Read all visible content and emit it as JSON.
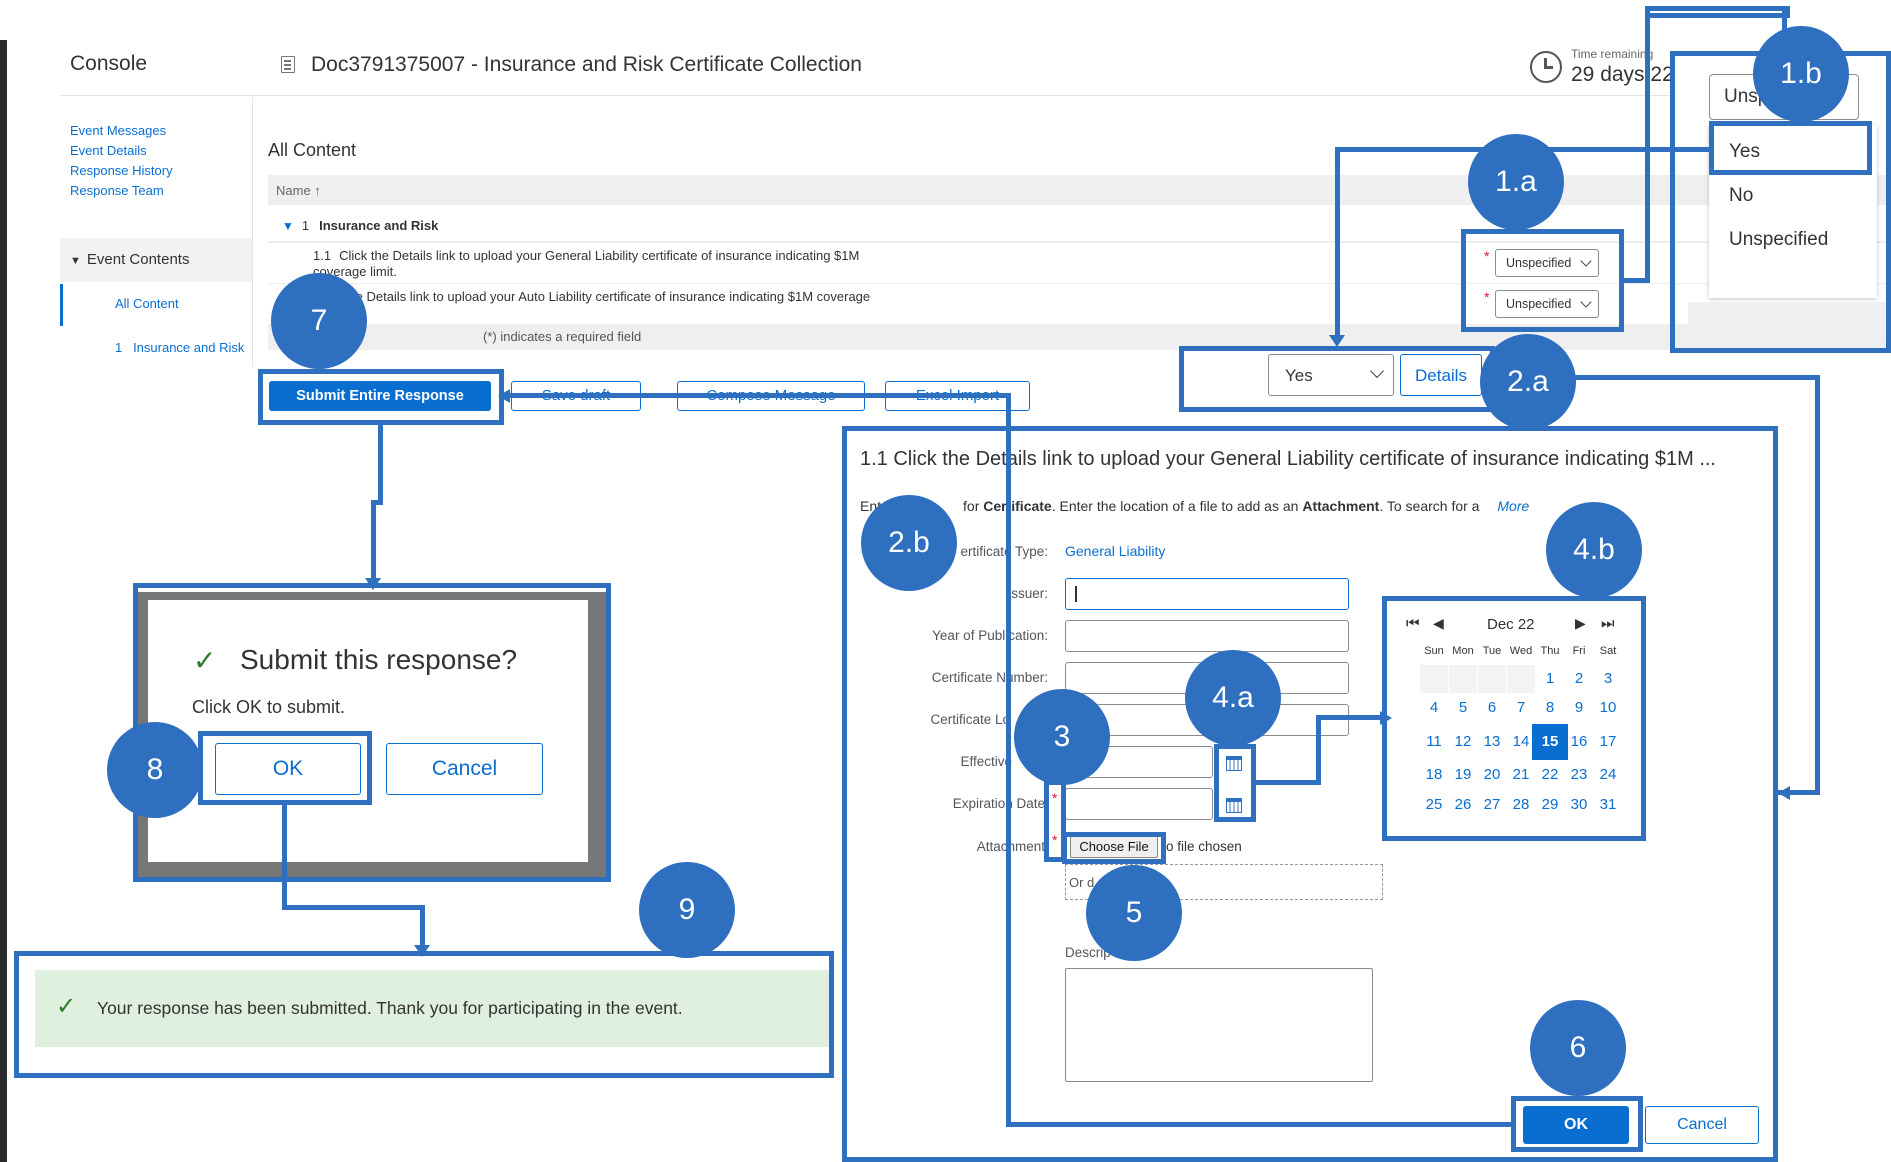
{
  "header": {
    "console": "Console",
    "doc_title": "Doc3791375007 - Insurance and Risk Certificate Collection",
    "time_label": "Time remaining",
    "time_value": "29 days 22"
  },
  "sidebar": {
    "links": [
      "Event Messages",
      "Event Details",
      "Response History",
      "Response Team"
    ],
    "event_contents": "Event Contents",
    "all_content": "All Content",
    "section_item": "1   Insurance and Risk"
  },
  "content": {
    "title": "All Content",
    "name_header": "Name ↑",
    "section_num": "1",
    "section_label": "Insurance and Risk",
    "q1_num": "1.1",
    "q1_text": "Click the Details link to upload your General Liability certificate of insurance indicating $1M coverage limit.",
    "q2_text": "Click the Details link to upload your Auto Liability certificate of insurance indicating $1M coverage limit.",
    "q1_value": "Unspecified",
    "q2_value": "Unspecified",
    "required_note": "(*) indicates a required field",
    "star": "*"
  },
  "buttons": {
    "submit": "Submit Entire Response",
    "save_draft": "Save draft",
    "compose": "Compose Message",
    "excel": "Excel Import"
  },
  "dropdown": {
    "current": "Unsp",
    "options": [
      "Yes",
      "No",
      "Unspecified"
    ]
  },
  "answer": {
    "value": "Yes",
    "details": "Details"
  },
  "details_panel": {
    "title": "1.1 Click the Details link to upload your General Liability certificate of insurance indicating $1M ...",
    "hint_pre": "Ent",
    "hint_mid1": "for",
    "hint_bold1": "Certificate",
    "hint_mid2": ". Enter the location of a file to add as an",
    "hint_bold2": "Attachment",
    "hint_end": ". To search for a",
    "more": "More",
    "labels": {
      "cert_type": "ertificate Type:",
      "issuer": "Issuer:",
      "year": "Year of Publication:",
      "cert_number": "Certificate Number:",
      "cert_loc": "Certificate Lo",
      "effective": "Effective",
      "expiration": "Expiration Date",
      "attachment": "Attachment",
      "description": "Descrip"
    },
    "cert_type_value": "General Liability",
    "choose_file": "Choose File",
    "no_file": "o file chosen",
    "drop_hint": "Or d",
    "ok": "OK",
    "cancel": "Cancel"
  },
  "calendar": {
    "month": "Dec 22",
    "weekdays": [
      "Sun",
      "Mon",
      "Tue",
      "Wed",
      "Thu",
      "Fri",
      "Sat"
    ],
    "weeks": [
      [
        "",
        "",
        "",
        "",
        "1",
        "2",
        "3"
      ],
      [
        "4",
        "5",
        "6",
        "7",
        "8",
        "9",
        "10"
      ],
      [
        "11",
        "12",
        "13",
        "14",
        "15",
        "16",
        "17"
      ],
      [
        "18",
        "19",
        "20",
        "21",
        "22",
        "23",
        "24"
      ],
      [
        "25",
        "26",
        "27",
        "28",
        "29",
        "30",
        "31"
      ]
    ],
    "selected": "15"
  },
  "dialog": {
    "title": "Submit this response?",
    "text": "Click OK to submit.",
    "ok": "OK",
    "cancel": "Cancel"
  },
  "success": {
    "text": "Your response has been submitted.  Thank you for participating in the event."
  },
  "steps": [
    "1.a",
    "1.b",
    "2.a",
    "2.b",
    "3",
    "4.a",
    "4.b",
    "5",
    "6",
    "7",
    "8",
    "9"
  ],
  "colors": {
    "annotation": "#2e6fbf",
    "primary": "#0a6ed1",
    "success_bg": "#e0f0df"
  }
}
